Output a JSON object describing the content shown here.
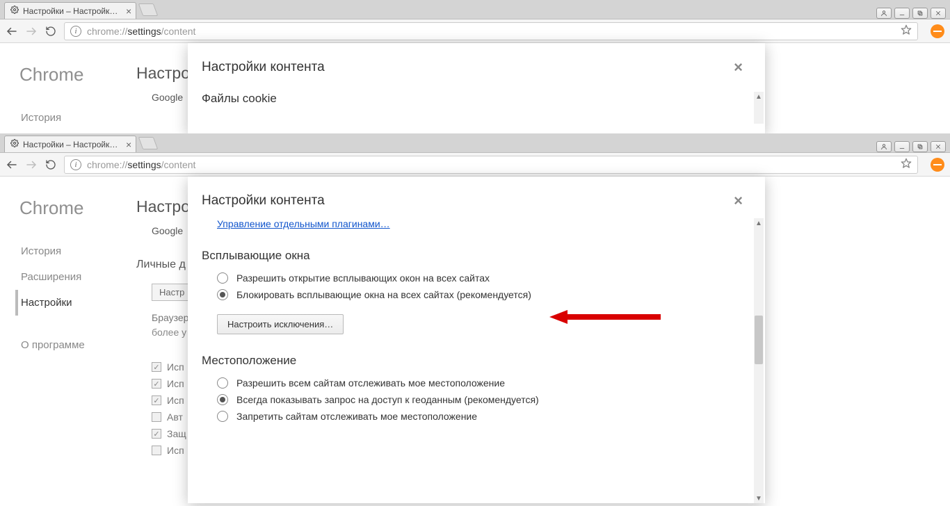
{
  "tab": {
    "title": "Настройки – Настройки к…",
    "close_glyph": "×"
  },
  "url": {
    "prefix": "chrome:",
    "sep": "//",
    "host": "settings",
    "path": "/content"
  },
  "browser_brand": "Chrome",
  "settings_heading": "Настрой",
  "bg_subs": {
    "google": "Google",
    "personal": "Личные",
    "personal_full": "Личные д",
    "nast_btn": "Настр",
    "browser_def": "Браузер",
    "more": "более у",
    "chk_isp": "Исп",
    "chk_avt": "Авт",
    "chk_zash": "Защ"
  },
  "sidebar": {
    "history": "История",
    "extensions": "Расширения",
    "settings": "Настройки",
    "about": "О программе"
  },
  "modal": {
    "title": "Настройки контента",
    "close_glyph": "×",
    "plugins_link": "Управление отдельными плагинами…",
    "cookies_header": "Файлы cookie",
    "popups": {
      "header": "Всплывающие окна",
      "allow": "Разрешить открытие всплывающих окон на всех сайтах",
      "block": "Блокировать всплывающие окна на всех сайтах (рекомендуется)",
      "exceptions_btn": "Настроить исключения…"
    },
    "location": {
      "header": "Местоположение",
      "allow": "Разрешить всем сайтам отслеживать мое местоположение",
      "ask": "Всегда показывать запрос на доступ к геоданным (рекомендуется)",
      "deny": "Запретить сайтам отслеживать мое местоположение"
    }
  }
}
